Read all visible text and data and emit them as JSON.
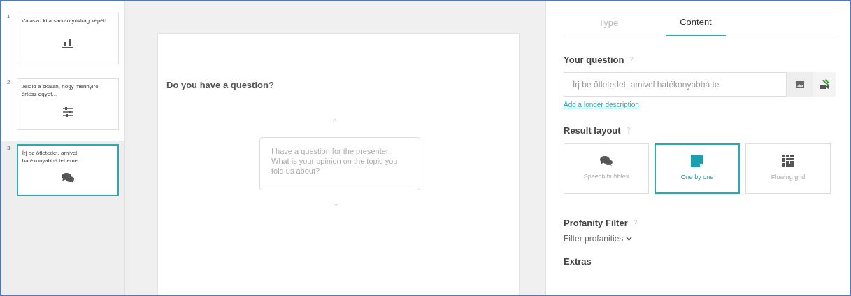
{
  "slides": [
    {
      "number": "1",
      "title": "Válaszd ki a sarkantyúvirág képét!",
      "kind": "image-choice",
      "selected": false
    },
    {
      "number": "2",
      "title": "Jelöld a skálán, hogy mennyire értesz egyet...",
      "kind": "scales",
      "selected": false
    },
    {
      "number": "3",
      "title": "Írj be ötletedet, amivel hatékonyabbá teheme...",
      "kind": "open-ended",
      "selected": true
    }
  ],
  "preview": {
    "question": "Do you have a question?",
    "answer": "I have a question for the presenter. What is your opinion on the topic you told us about?",
    "up": "^",
    "down": "⌄"
  },
  "tabs": [
    {
      "label": "Type",
      "selected": false
    },
    {
      "label": "Content",
      "selected": true
    }
  ],
  "question_section": {
    "label": "Your question",
    "help": "?",
    "value": "Írj be ötletedet, amivel hatékonyabbá te",
    "link": "Add a longer description"
  },
  "layout_section": {
    "label": "Result layout",
    "help": "?",
    "options": [
      {
        "label": "Speech bubbles",
        "kind": "bubbles",
        "selected": false
      },
      {
        "label": "One by one",
        "kind": "single",
        "selected": true
      },
      {
        "label": "Flowing grid",
        "kind": "grid",
        "selected": false
      }
    ]
  },
  "profanity_section": {
    "label": "Profanity Filter",
    "help": "?",
    "dropdown": "Filter profanities"
  },
  "extras_label": "Extras"
}
